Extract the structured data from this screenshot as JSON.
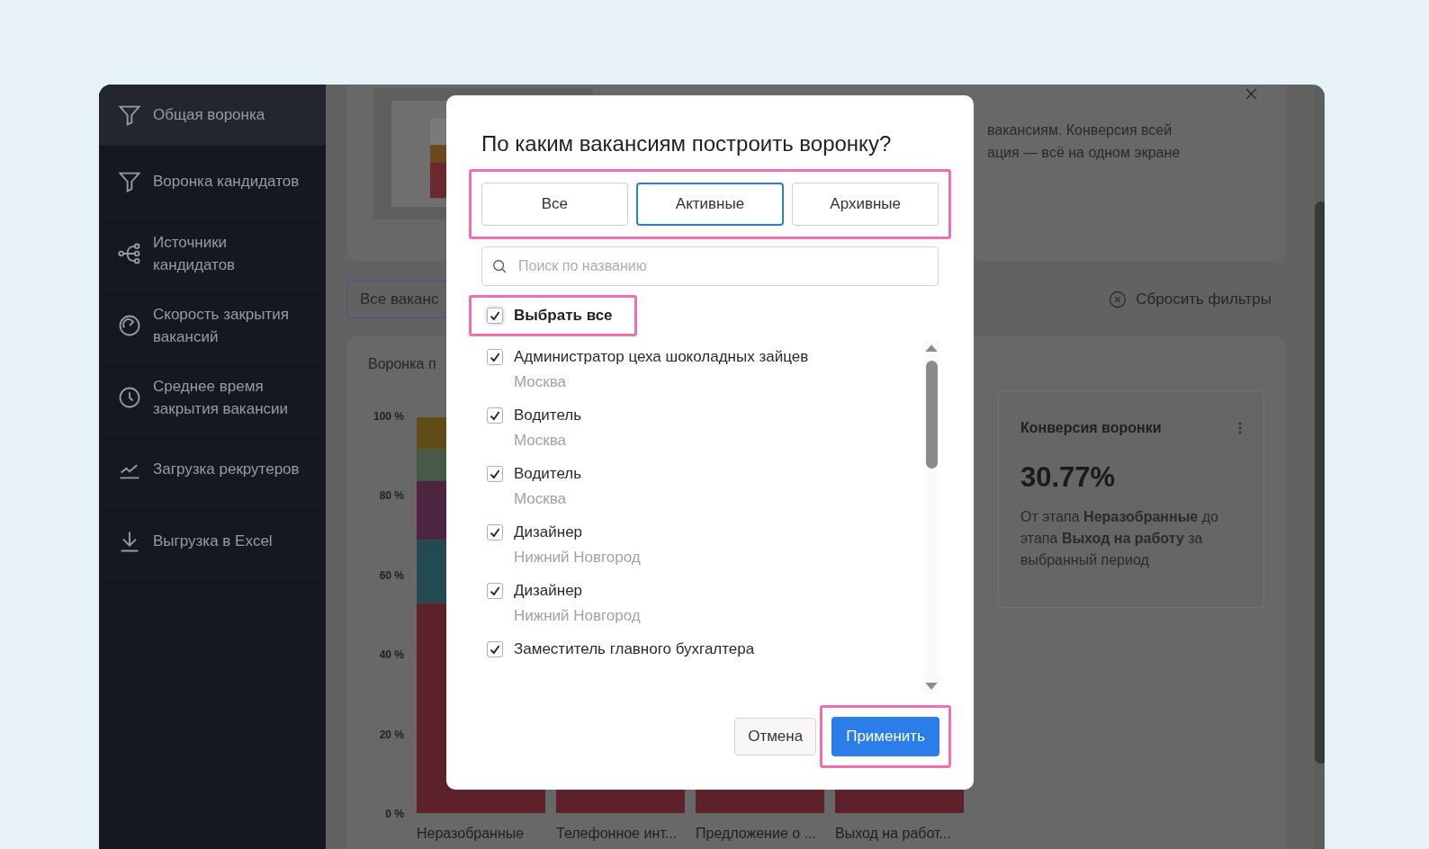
{
  "sidebar": {
    "items": [
      {
        "label": "Общая воронка",
        "selected": true
      },
      {
        "label": "Воронка кандидатов",
        "selected": false
      },
      {
        "label": "Источники кандидатов",
        "selected": false
      },
      {
        "label": "Скорость закрытия вакансий",
        "selected": false
      },
      {
        "label": "Среднее время закрытия вакансии",
        "selected": false
      },
      {
        "label": "Загрузка рекрутеров",
        "selected": false
      },
      {
        "label": "Выгрузка в Excel",
        "selected": false
      }
    ]
  },
  "banner": {
    "lines": [
      "вакансиям. Конверсия всей",
      "ация — всё на одном экране"
    ]
  },
  "filters": {
    "vacancy_button": "Все ваканс",
    "reset": "Сбросить фильтры"
  },
  "funnel_card": {
    "title": "Воронка п",
    "y_ticks": [
      "100 %",
      "80 %",
      "60 %",
      "40 %",
      "20 %",
      "0 %"
    ],
    "categories": [
      "Неразобранные",
      "Телефонное инт...",
      "Предложение о ...",
      "Выход на работ..."
    ]
  },
  "conversion_card": {
    "title": "Конверсия воронки",
    "value": "30.77%",
    "description": "От этапа **Неразобранные** до этапа **Выход на работу** за выбранный период"
  },
  "modal": {
    "title": "По каким вакансиям построить воронку?",
    "segments": [
      {
        "label": "Все",
        "selected": false
      },
      {
        "label": "Активные",
        "selected": true
      },
      {
        "label": "Архивные",
        "selected": false
      }
    ],
    "search": {
      "placeholder": "Поиск по названию"
    },
    "select_all": {
      "label": "Выбрать все",
      "checked": true
    },
    "items": [
      {
        "title": "Администратор цеха шоколадных зайцев",
        "city": "Москва",
        "checked": true
      },
      {
        "title": "Водитель",
        "city": "Москва",
        "checked": true
      },
      {
        "title": "Водитель",
        "city": "Москва",
        "checked": true
      },
      {
        "title": "Дизайнер",
        "city": "Нижний Новгород",
        "checked": true
      },
      {
        "title": "Дизайнер",
        "city": "Нижний Новгород",
        "checked": true
      },
      {
        "title": "Заместитель главного бухгалтера",
        "checked": true
      }
    ],
    "cancel": "Отмена",
    "apply": "Применить"
  }
}
